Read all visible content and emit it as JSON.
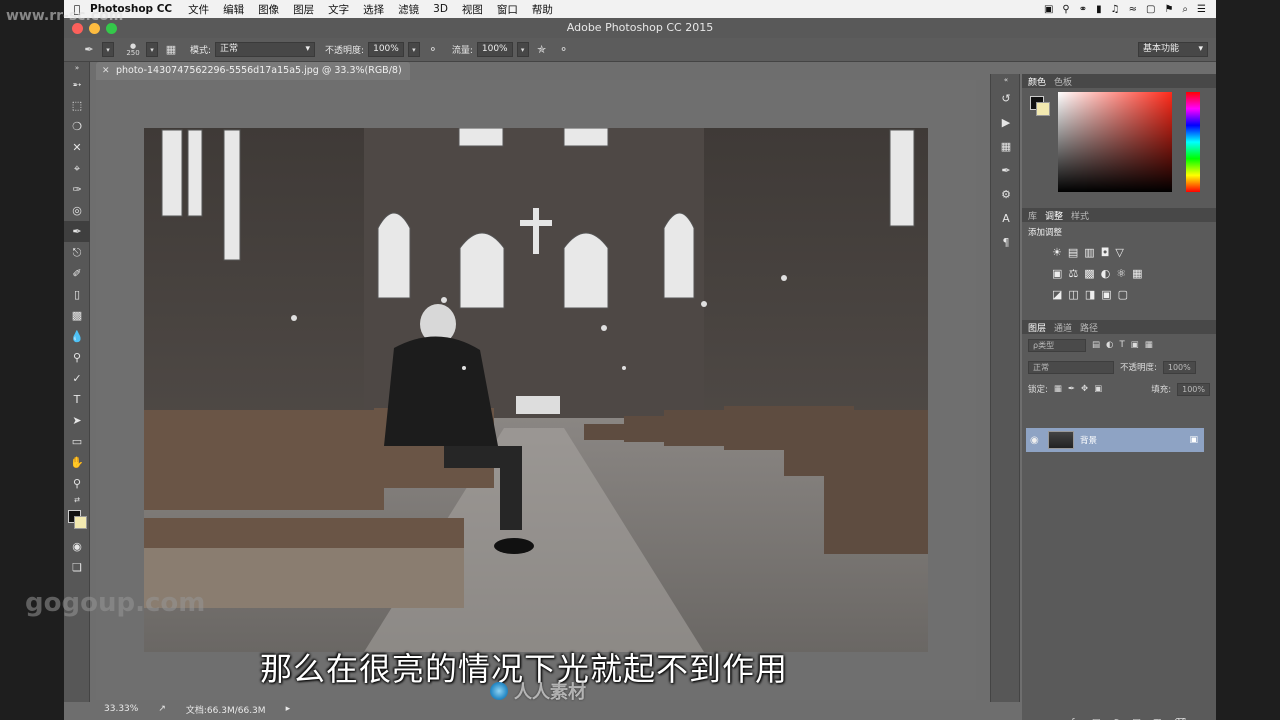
{
  "watermark": {
    "site": "www.rr-sc.com",
    "left_logo": "gogoup.com",
    "bottom_logo": "人人素材"
  },
  "menubar": {
    "app_name": "Photoshop CC",
    "items": [
      "文件",
      "编辑",
      "图像",
      "图层",
      "文字",
      "选择",
      "滤镜",
      "3D",
      "视图",
      "窗口",
      "帮助"
    ]
  },
  "window": {
    "title": "Adobe Photoshop CC 2015"
  },
  "options_bar": {
    "brush_size": "250",
    "mode_label": "模式:",
    "mode_value": "正常",
    "opacity_label": "不透明度:",
    "opacity_value": "100%",
    "flow_label": "流量:",
    "flow_value": "100%",
    "workspace": "基本功能"
  },
  "document": {
    "tab_title": "photo-1430747562296-5556d17a15a5.jpg @ 33.3%(RGB/8)",
    "zoom": "33.33%",
    "doc_info": "文档:66.3M/66.3M"
  },
  "subtitle": "那么在很亮的情况下光就起不到作用",
  "panels": {
    "color_tabs": [
      "颜色",
      "色板"
    ],
    "adjust_tabs": [
      "库",
      "调整",
      "样式"
    ],
    "adjust_title": "添加调整",
    "layers_tabs": [
      "图层",
      "通道",
      "路径"
    ],
    "kind_filter": "ρ类型",
    "blend_mode": "正常",
    "opacity_label": "不透明度:",
    "opacity_value": "100%",
    "lock_label": "锁定:",
    "fill_label": "填充:",
    "fill_value": "100%",
    "layer_name": "背景"
  },
  "colors": {
    "foreground": "#111111",
    "background": "#f2e9b0",
    "selected_layer": "#8ea3c4"
  }
}
